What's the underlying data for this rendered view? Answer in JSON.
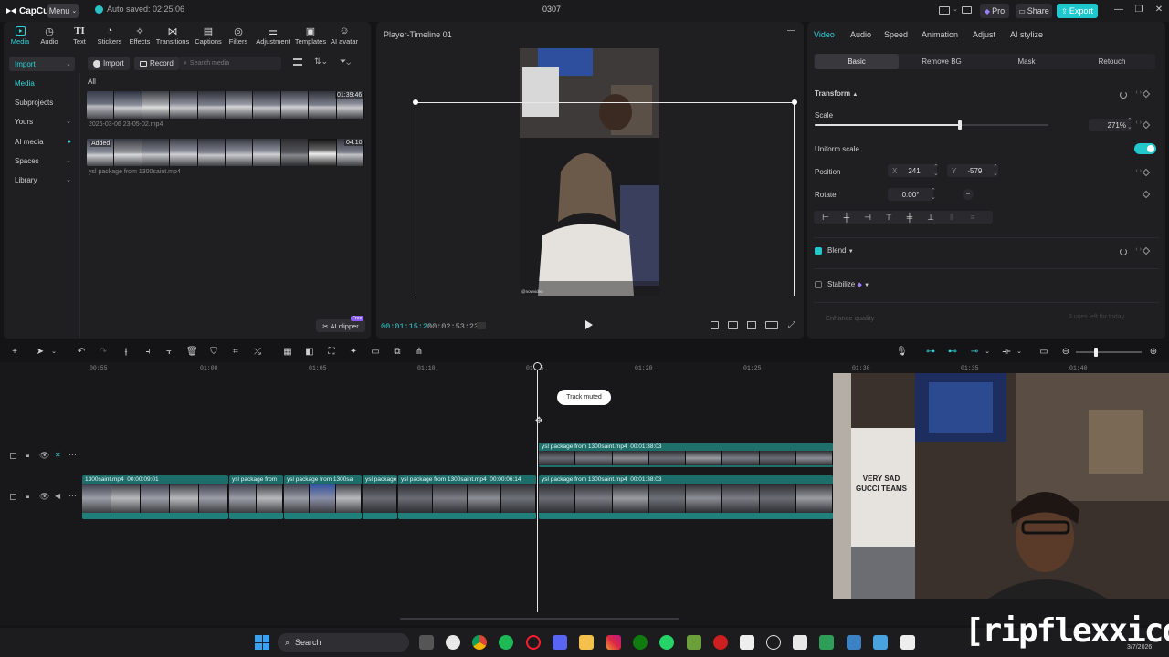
{
  "app": {
    "name": "CapCut",
    "menu_label": "Menu",
    "autosave": "Auto saved: 02:25:06",
    "project_title": "0307",
    "pro_label": "Pro",
    "share_label": "Share",
    "export_label": "Export"
  },
  "toolbar_tabs": [
    {
      "label": "Media",
      "icon": "media-icon"
    },
    {
      "label": "Audio",
      "icon": "audio-icon"
    },
    {
      "label": "Text",
      "icon": "text-icon"
    },
    {
      "label": "Stickers",
      "icon": "stickers-icon"
    },
    {
      "label": "Effects",
      "icon": "effects-icon"
    },
    {
      "label": "Transitions",
      "icon": "transitions-icon"
    },
    {
      "label": "Captions",
      "icon": "captions-icon"
    },
    {
      "label": "Filters",
      "icon": "filters-icon"
    },
    {
      "label": "Adjustment",
      "icon": "adjustment-icon"
    },
    {
      "label": "Templates",
      "icon": "templates-icon"
    },
    {
      "label": "AI avatar",
      "icon": "ai-avatar-icon"
    }
  ],
  "sidebar": {
    "items": [
      "Import",
      "Media",
      "Subprojects",
      "Yours",
      "AI media",
      "Spaces",
      "Library"
    ]
  },
  "media": {
    "import_label": "Import",
    "record_label": "Record",
    "search_placeholder": "Search media",
    "filter_all": "All",
    "items": [
      {
        "name": "2026-03-06 23-05-02.mp4",
        "duration": "01:39:46",
        "badge": ""
      },
      {
        "name": "ysl package from 1300saint.mp4",
        "duration": "04:10",
        "badge": "Added"
      }
    ],
    "ai_clipper_label": "AI clipper",
    "ai_clipper_badge": "Free"
  },
  "player": {
    "title": "Player-Timeline 01",
    "current_time": "00:01:15:20",
    "total_time": "00:02:53:23",
    "video_caption": "@nowvideo"
  },
  "properties": {
    "tabs": [
      "Video",
      "Audio",
      "Speed",
      "Animation",
      "Adjust",
      "AI stylize"
    ],
    "subtabs": [
      "Basic",
      "Remove BG",
      "Mask",
      "Retouch"
    ],
    "transform_label": "Transform",
    "scale_label": "Scale",
    "scale_value": "271%",
    "scale_fraction": 0.62,
    "uniform_scale_label": "Uniform scale",
    "position_label": "Position",
    "pos_x_label": "X",
    "pos_x": "241",
    "pos_y_label": "Y",
    "pos_y": "-579",
    "rotate_label": "Rotate",
    "rotate_value": "0.00°",
    "blend_label": "Blend",
    "stabilize_label": "Stabilize",
    "enhance_label": "Enhance quality",
    "enhance_note": "3 uses left for today"
  },
  "timeline": {
    "ruler": [
      "00:55",
      "01:00",
      "01:05",
      "01:10",
      "01:15",
      "01:20",
      "01:25",
      "01:30",
      "01:35",
      "01:40"
    ],
    "toast": "Track muted",
    "upper_clip": {
      "name": "ysl package from 1300saint.mp4",
      "duration": "00:01:38:03"
    },
    "main_clips": [
      {
        "name": "1300saint.mp4",
        "duration": "00:00:09:01"
      },
      {
        "name": "ysl package from",
        "duration": ""
      },
      {
        "name": "ysl package from 1300sa",
        "duration": ""
      },
      {
        "name": "ysl package",
        "duration": ""
      },
      {
        "name": "ysl package from 1300saint.mp4",
        "duration": "00:00:06:14"
      },
      {
        "name": "ysl package from 1300saint.mp4",
        "duration": "00:01:38:03"
      }
    ]
  },
  "webcam": {
    "shirt_text_1": "VERY SAD",
    "shirt_text_2": "GUCCI TEAMS"
  },
  "taskbar": {
    "search_label": "Search",
    "date": "3/7/2026"
  },
  "watermark": "[ripflexxico]"
}
